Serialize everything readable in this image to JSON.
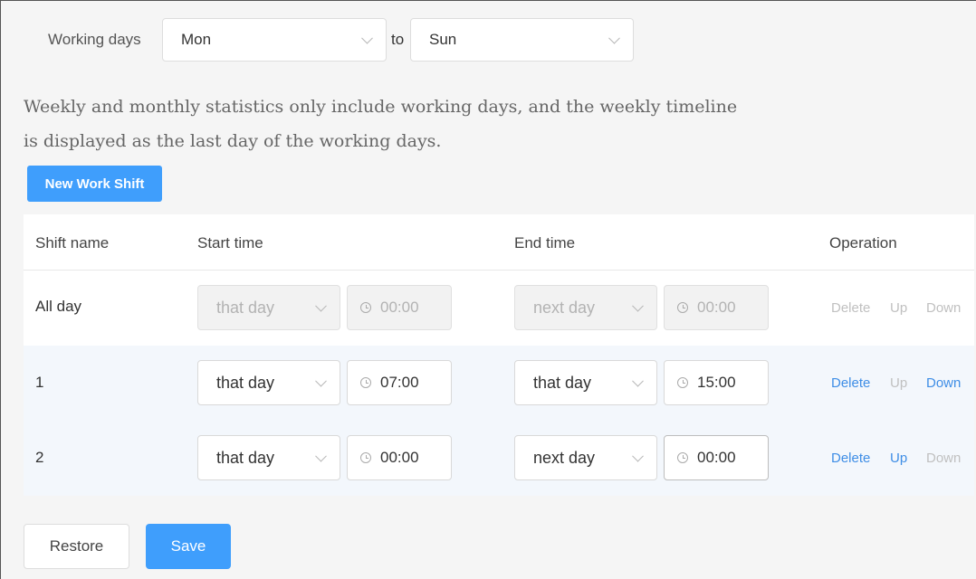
{
  "working_days": {
    "label": "Working days",
    "from": "Mon",
    "to_label": "to",
    "to": "Sun"
  },
  "description": {
    "line1": "Weekly and monthly statistics only include working days, and the weekly timeline",
    "line2": "is displayed as the last day of the working days."
  },
  "new_shift_button": "New Work Shift",
  "table": {
    "headers": {
      "name": "Shift name",
      "start": "Start time",
      "end": "End time",
      "operation": "Operation"
    },
    "rows": [
      {
        "name": "All day",
        "start_day": "that day",
        "start_time": "00:00",
        "end_day": "next day",
        "end_time": "00:00",
        "delete": "Delete",
        "up": "Up",
        "down": "Down",
        "disabled": true
      },
      {
        "name": "1",
        "start_day": "that day",
        "start_time": "07:00",
        "end_day": "that day",
        "end_time": "15:00",
        "delete": "Delete",
        "up": "Up",
        "down": "Down",
        "disabled": false
      },
      {
        "name": "2",
        "start_day": "that day",
        "start_time": "00:00",
        "end_day": "next day",
        "end_time": "00:00",
        "delete": "Delete",
        "up": "Up",
        "down": "Down",
        "disabled": false
      }
    ]
  },
  "footer": {
    "restore": "Restore",
    "save": "Save"
  },
  "colors": {
    "primary": "#3f9efc",
    "link": "#3f8ee6",
    "disabled_text": "#c0c0c0",
    "row_alt_bg": "#f3f7fc",
    "page_bg": "#f5f5f5"
  },
  "icons": {
    "time": "clock-icon",
    "dropdown": "chevron-down-icon"
  }
}
